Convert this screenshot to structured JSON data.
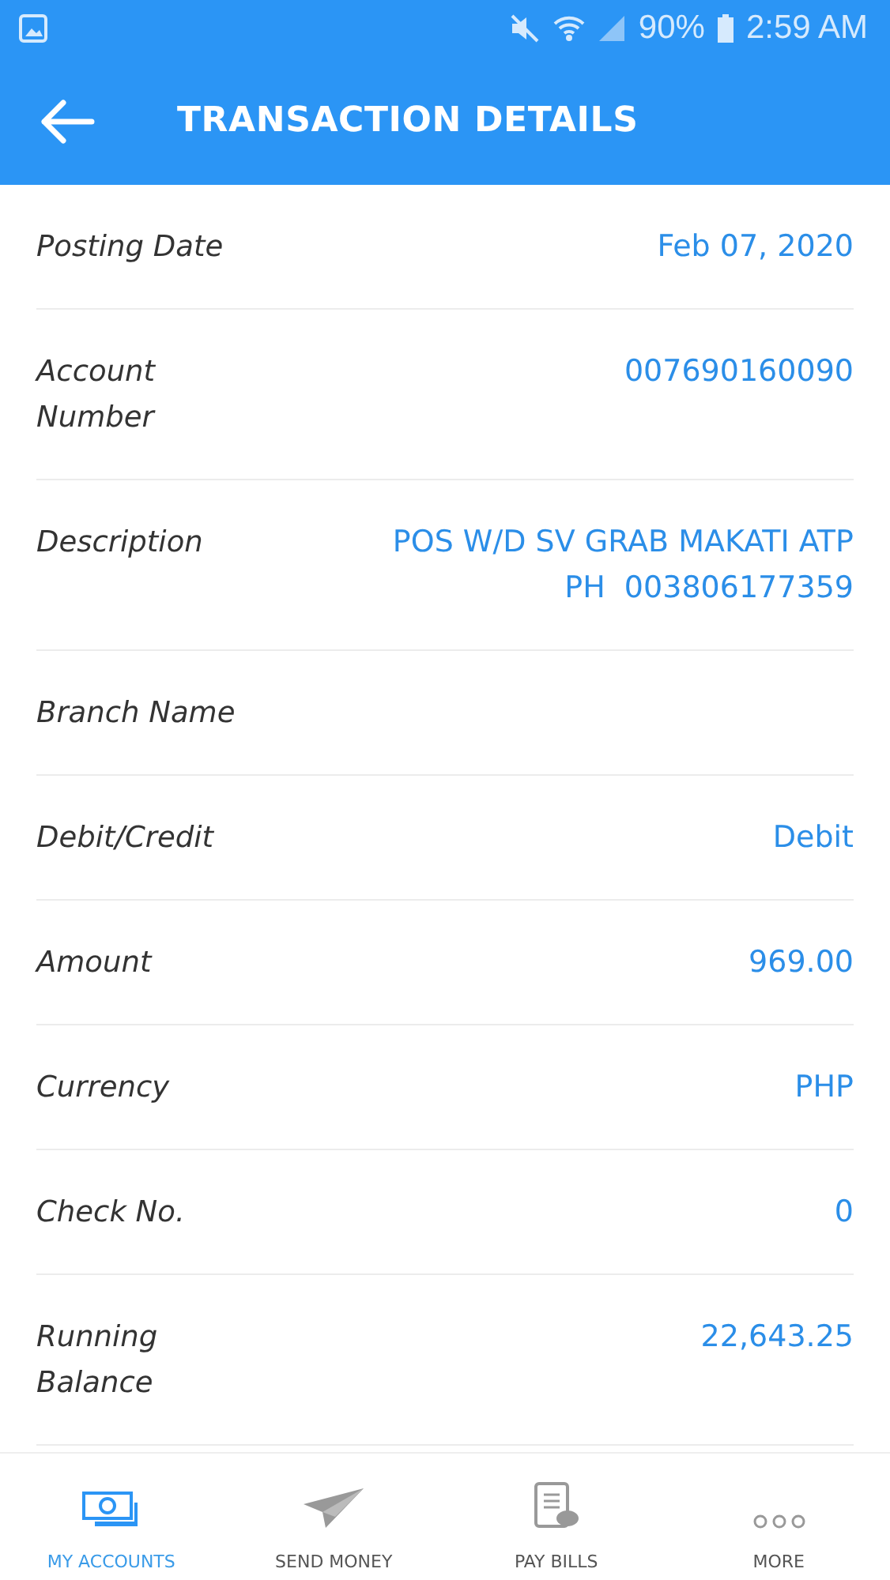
{
  "status_bar": {
    "battery": "90%",
    "time": "2:59 AM"
  },
  "header": {
    "title": "TRANSACTION DETAILS"
  },
  "details": [
    {
      "label": "Posting Date",
      "value": "Feb 07, 2020"
    },
    {
      "label": "Account Number",
      "value": "007690160090"
    },
    {
      "label": "Description",
      "value": "POS W/D SV GRAB MAKATI ATP PH  003806177359"
    },
    {
      "label": "Branch Name"
    },
    {
      "label": "Debit/Credit",
      "value": "Debit"
    },
    {
      "label": "Amount",
      "value": "969.00"
    },
    {
      "label": "Currency",
      "value": "PHP"
    },
    {
      "label": "Check No.",
      "value": "0"
    },
    {
      "label": "Running Balance",
      "value": "22,643.25"
    }
  ],
  "bottom_nav": [
    {
      "kind": "accounts",
      "label": "MY ACCOUNTS",
      "selected": true
    },
    {
      "kind": "send",
      "label": "SEND MONEY",
      "selected": false
    },
    {
      "kind": "bills",
      "label": "PAY BILLS",
      "selected": false
    },
    {
      "kind": "more",
      "label": "MORE",
      "selected": false
    }
  ]
}
